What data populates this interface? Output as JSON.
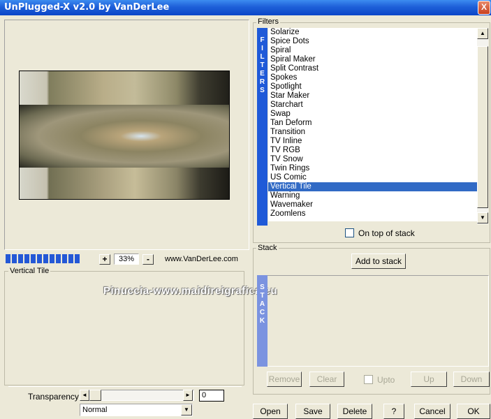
{
  "window": {
    "title": "UnPlugged-X v2.0 by VanDerLee",
    "close_label": "X"
  },
  "preview": {
    "progress_segments": 12,
    "zoom_minus": "-",
    "zoom_plus": "+",
    "zoom_value": "33%",
    "site": "www.VanDerLee.com"
  },
  "settings": {
    "group_label": "Vertical Tile",
    "transparency_label": "Transparency",
    "transparency_value": "0",
    "slider_left": "◄",
    "slider_right": "►",
    "blend_mode": "Normal",
    "dropdown_arrow": "▼"
  },
  "filters": {
    "group_label": "Filters",
    "strip_letters": [
      "F",
      "I",
      "L",
      "T",
      "E",
      "R",
      "S"
    ],
    "items": [
      "Solarize",
      "Spice Dots",
      "Spiral",
      "Spiral Maker",
      "Split Contrast",
      "Spokes",
      "Spotlight",
      "Star Maker",
      "Starchart",
      "Swap",
      "Tan Deform",
      "Transition",
      "TV Inline",
      "TV RGB",
      "TV Snow",
      "Twin Rings",
      "US Comic",
      "Vertical Tile",
      "Warning",
      "Wavemaker",
      "Zoomlens"
    ],
    "selected": "Vertical Tile",
    "on_top_label": "On top of stack",
    "on_top_checked": false,
    "scroll_up": "▲",
    "scroll_down": "▼"
  },
  "stack": {
    "group_label": "Stack",
    "add_button": "Add to stack",
    "strip_letters": [
      "S",
      "T",
      "A",
      "C",
      "K"
    ],
    "buttons": {
      "remove": "Remove",
      "clear": "Clear",
      "upto": "Upto",
      "up": "Up",
      "down": "Down"
    },
    "upto_checked": false
  },
  "footer": {
    "open": "Open",
    "save": "Save",
    "delete": "Delete",
    "help": "?",
    "cancel": "Cancel",
    "ok": "OK"
  },
  "watermark": "Pinuccia-www.maidireigrafica.eu",
  "colors": {
    "title_blue": "#0a46c8",
    "select_blue": "#316ac5",
    "filters_strip": "#1f5ad8",
    "stack_strip": "#7b93e0",
    "background": "#ece9d8"
  }
}
